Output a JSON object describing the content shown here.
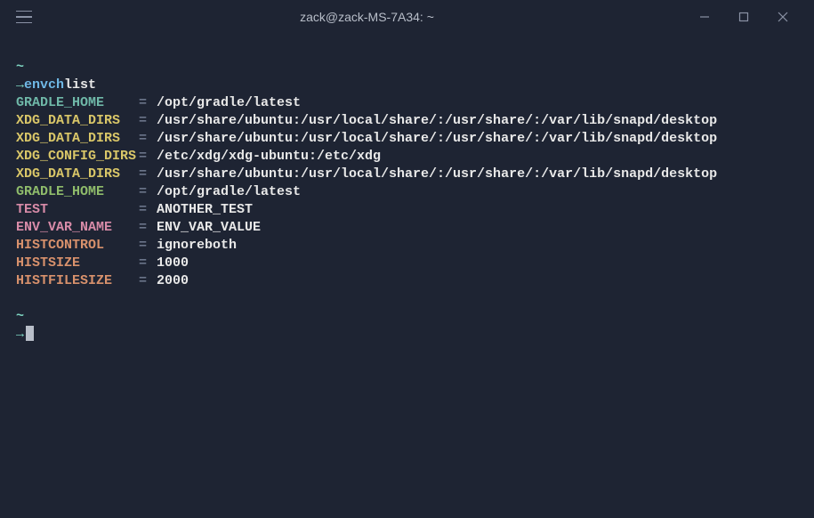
{
  "window": {
    "title": "zack@zack-MS-7A34: ~"
  },
  "prompt": {
    "tilde": "~",
    "arrow": "→",
    "command": "envch",
    "arg": "list"
  },
  "vars": [
    {
      "name": "GRADLE_HOME",
      "value": "/opt/gradle/latest",
      "color": "col-teal"
    },
    {
      "name": "XDG_DATA_DIRS",
      "value": "/usr/share/ubuntu:/usr/local/share/:/usr/share/:/var/lib/snapd/desktop",
      "color": "col-yellow"
    },
    {
      "name": "XDG_DATA_DIRS",
      "value": "/usr/share/ubuntu:/usr/local/share/:/usr/share/:/var/lib/snapd/desktop",
      "color": "col-yellow"
    },
    {
      "name": "XDG_CONFIG_DIRS",
      "value": "/etc/xdg/xdg-ubuntu:/etc/xdg",
      "color": "col-yellow"
    },
    {
      "name": "XDG_DATA_DIRS",
      "value": "/usr/share/ubuntu:/usr/local/share/:/usr/share/:/var/lib/snapd/desktop",
      "color": "col-yellow"
    },
    {
      "name": "GRADLE_HOME",
      "value": "/opt/gradle/latest",
      "color": "col-green"
    },
    {
      "name": "TEST",
      "value": "ANOTHER_TEST",
      "color": "col-pink"
    },
    {
      "name": "ENV_VAR_NAME",
      "value": "ENV_VAR_VALUE",
      "color": "col-pink"
    },
    {
      "name": "HISTCONTROL",
      "value": "ignoreboth",
      "color": "col-salmon"
    },
    {
      "name": "HISTSIZE",
      "value": "1000",
      "color": "col-salmon"
    },
    {
      "name": "HISTFILESIZE",
      "value": "2000",
      "color": "col-salmon"
    }
  ],
  "eq": "="
}
